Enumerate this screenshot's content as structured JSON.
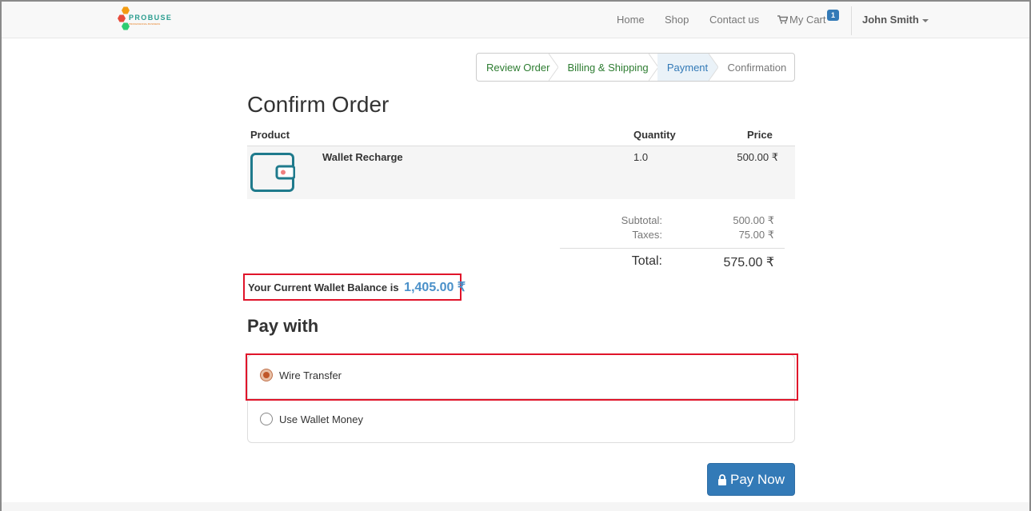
{
  "brand": {
    "name": "PROBUSE",
    "tagline": "PROFESSIONAL BUSINESS"
  },
  "nav": {
    "home": "Home",
    "shop": "Shop",
    "contact": "Contact us",
    "cart": "My Cart",
    "cart_count": "1",
    "user": "John Smith"
  },
  "steps": [
    {
      "label": "Review Order",
      "state": "done"
    },
    {
      "label": "Billing & Shipping",
      "state": "done"
    },
    {
      "label": "Payment",
      "state": "active"
    },
    {
      "label": "Confirmation",
      "state": "todo"
    }
  ],
  "page_title": "Confirm Order",
  "table": {
    "headers": {
      "product": "Product",
      "quantity": "Quantity",
      "price": "Price"
    },
    "rows": [
      {
        "product": "Wallet Recharge",
        "quantity": "1.0",
        "price": "500.00 ₹",
        "icon": "wallet-icon"
      }
    ]
  },
  "totals": {
    "subtotal_label": "Subtotal:",
    "subtotal": "500.00 ₹",
    "taxes_label": "Taxes:",
    "taxes": "75.00 ₹",
    "total_label": "Total:",
    "total": "575.00 ₹"
  },
  "wallet": {
    "label": "Your Current Wallet Balance is",
    "balance": "1,405.00 ₹"
  },
  "pay_with": {
    "title": "Pay with",
    "options": [
      {
        "label": "Wire Transfer",
        "selected": true
      },
      {
        "label": "Use Wallet Money",
        "selected": false
      }
    ]
  },
  "pay_button": "Pay Now",
  "colors": {
    "primary": "#337ab7",
    "highlight": "#e0142a",
    "step_done": "#2e7d32",
    "balance": "#4a90c9"
  }
}
